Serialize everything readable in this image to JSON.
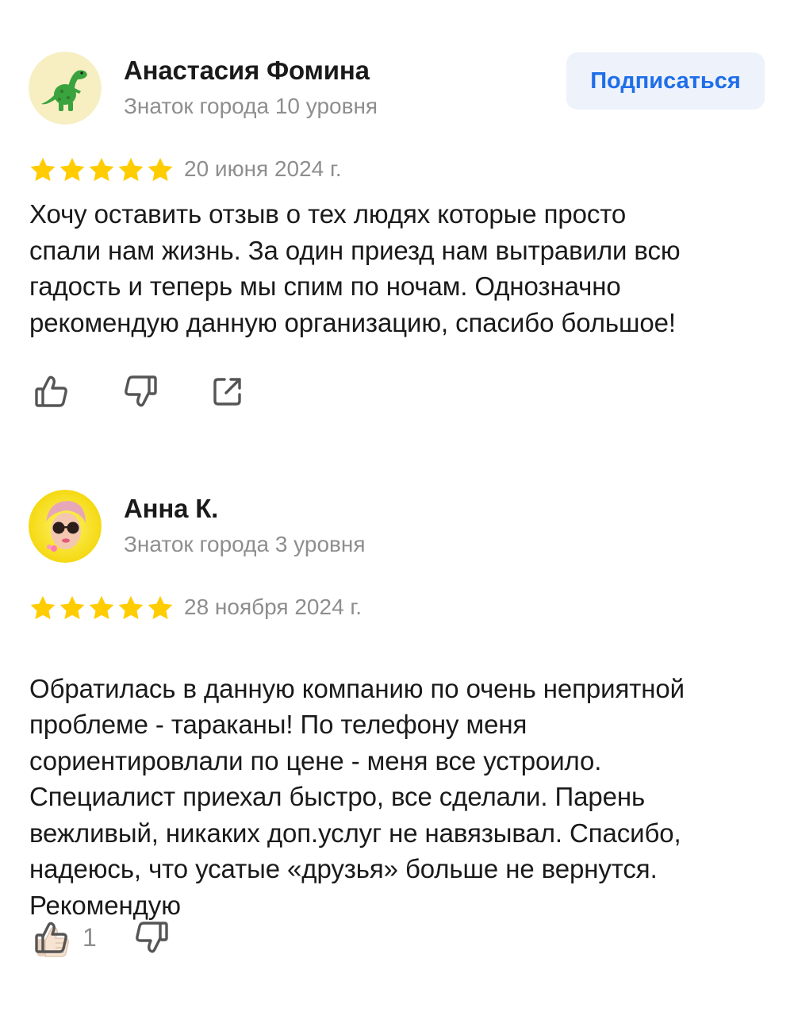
{
  "colors": {
    "star": "#ffcc00",
    "accent": "#1f6ee8",
    "muted_text": "#8e8e8e",
    "icon": "#555555"
  },
  "reviews": [
    {
      "author": {
        "name": "Анастасия Фомина",
        "level": "Знаток города 10 уровня",
        "avatar_icon": "dinosaur-avatar"
      },
      "subscribe_label": "Подписаться",
      "rating": 5,
      "date": "20 июня 2024 г.",
      "text": "Хочу оставить отзыв о тех людях которые просто\nспали нам жизнь. За один приезд нам вытравили всю\nгадость и теперь мы спим по ночам. Однозначно\nрекомендую данную организацию, спасибо большое!",
      "actions": {
        "like_icon": "thumbs-up-icon",
        "dislike_icon": "thumbs-down-icon",
        "share_icon": "share-icon"
      }
    },
    {
      "author": {
        "name": "Анна К.",
        "level": "Знаток города 3 уровня",
        "avatar_icon": "woman-sunglasses-avatar"
      },
      "rating": 5,
      "date": "28 ноября 2024 г.",
      "text": "Обратилась в данную компанию по очень неприятной\nпроблеме - тараканы! По телефону меня\nсориентировлали по цене - меня все устроило.\nСпециалист приехал быстро, все сделали. Парень\nвежливый, никаких доп.услуг не навязывал. Спасибо,\nнадеюсь, что усатые  «друзья» больше не вернутся.\nРекомендую",
      "actions": {
        "like_icon": "thumbs-up-icon",
        "like_count": "1",
        "dislike_icon": "thumbs-down-icon"
      }
    }
  ]
}
